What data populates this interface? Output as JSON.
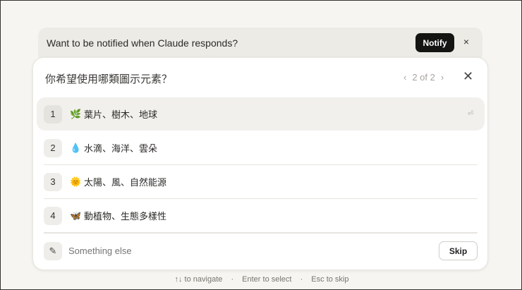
{
  "banner": {
    "text": "Want to be notified when Claude responds?",
    "notify": "Notify",
    "close": "×"
  },
  "question": {
    "title": "你希望使用哪類圖示元素？",
    "pager": "2 of 2",
    "prev": "‹",
    "next": "›",
    "close": "✕"
  },
  "options": [
    {
      "num": "1",
      "emoji": "🌿",
      "label": "葉片、樹木、地球"
    },
    {
      "num": "2",
      "emoji": "💧",
      "label": "水滴、海洋、雲朵"
    },
    {
      "num": "3",
      "emoji": "🌞",
      "label": "太陽、風、自然能源"
    },
    {
      "num": "4",
      "emoji": "🦋",
      "label": "動植物、生態多樣性"
    }
  ],
  "return_hint": "⏎",
  "other": {
    "placeholder": "Something else",
    "skip": "Skip"
  },
  "footer": {
    "navigate": "↑↓ to navigate",
    "select": "Enter to select",
    "skip": "Esc to skip",
    "sep": "·"
  }
}
